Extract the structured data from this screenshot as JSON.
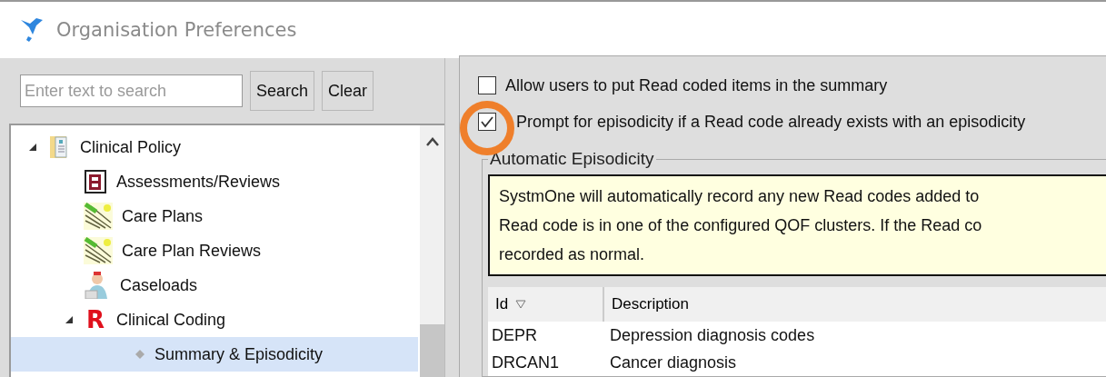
{
  "window": {
    "title": "Organisation Preferences"
  },
  "search": {
    "placeholder": "Enter text to search",
    "buttons": [
      {
        "label": "Search"
      },
      {
        "label": "Clear"
      }
    ]
  },
  "tree": [
    {
      "label": "Clinical Policy",
      "expanded": true,
      "selected": false,
      "children": [
        {
          "label": "Assessments/Reviews",
          "selected": false
        },
        {
          "label": "Care Plans",
          "selected": false
        },
        {
          "label": "Care Plan Reviews",
          "selected": false
        },
        {
          "label": "Caseloads",
          "selected": false
        },
        {
          "label": "Clinical Coding",
          "glyph": "R",
          "expanded": true,
          "selected": false,
          "children": [
            {
              "label": "Summary & Episodicity",
              "selected": true
            }
          ]
        }
      ]
    }
  ],
  "options": [
    {
      "label": "Allow users to put Read coded items in the summary",
      "checked": false,
      "highlighted": false
    },
    {
      "label": "Prompt for episodicity if a Read code already exists with an episodicity",
      "checked": true,
      "highlighted": true
    }
  ],
  "group": {
    "title": "Automatic Episodicity",
    "notice_lines": [
      "SystmOne will automatically record any new Read codes added to",
      "Read code is in one of the configured QOF clusters. If the Read co",
      "recorded as normal."
    ],
    "table": {
      "columns": [
        {
          "label": "Id",
          "sorted": true
        },
        {
          "label": "Description",
          "sorted": false
        }
      ],
      "rows": [
        [
          "DEPR",
          "Depression diagnosis codes"
        ],
        [
          "DRCAN1",
          "Cancer diagnosis"
        ]
      ]
    }
  }
}
